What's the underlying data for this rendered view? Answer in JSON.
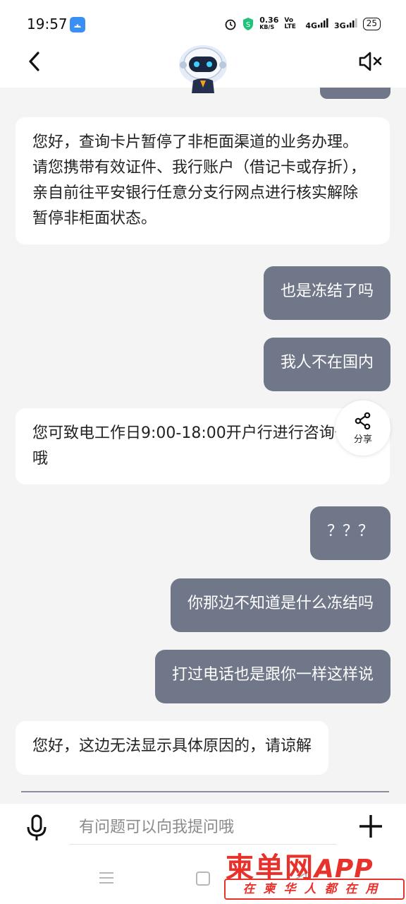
{
  "status_bar": {
    "time": "19:57",
    "net_speed": "0.36",
    "net_unit": "KB/S",
    "volte": "Vo LTE",
    "signal_1": "4G",
    "signal_2": "3G",
    "battery": "25"
  },
  "header": {
    "back_icon": "chevron-left-icon",
    "avatar_icon": "robot-assistant-avatar",
    "mute_icon": "speaker-muted-icon"
  },
  "messages": [
    {
      "role": "bot",
      "text": "您好，查询卡片暂停了非柜面渠道的业务办理。请您携带有效证件、我行账户（借记卡或存折），亲自前往平安银行任意分支行网点进行核实解除暂停非柜面状态。"
    },
    {
      "role": "user",
      "text": "也是冻结了吗"
    },
    {
      "role": "user",
      "text": "我人不在国内"
    },
    {
      "role": "bot",
      "text": "您可致电工作日9:00-18:00开户行进行咨询一下哦"
    },
    {
      "role": "user",
      "text": "？？？"
    },
    {
      "role": "user",
      "text": "你那边不知道是什么冻结吗"
    },
    {
      "role": "user",
      "text": "打过电话也是跟你一样这样说"
    },
    {
      "role": "bot",
      "text": "您好，这边无法显示具体原因的，请谅解"
    }
  ],
  "share": {
    "label": "分享",
    "icon": "share-icon"
  },
  "input": {
    "placeholder": "有问题可以向我提问哦"
  },
  "colors": {
    "user_bubble": "#6f7788",
    "bot_bubble": "#ffffff",
    "background": "#f4f4f4",
    "watermark": "#e8312b"
  },
  "watermark": {
    "title": "柬单网",
    "app": "APP",
    "subtitle": "在柬华人都在用"
  }
}
